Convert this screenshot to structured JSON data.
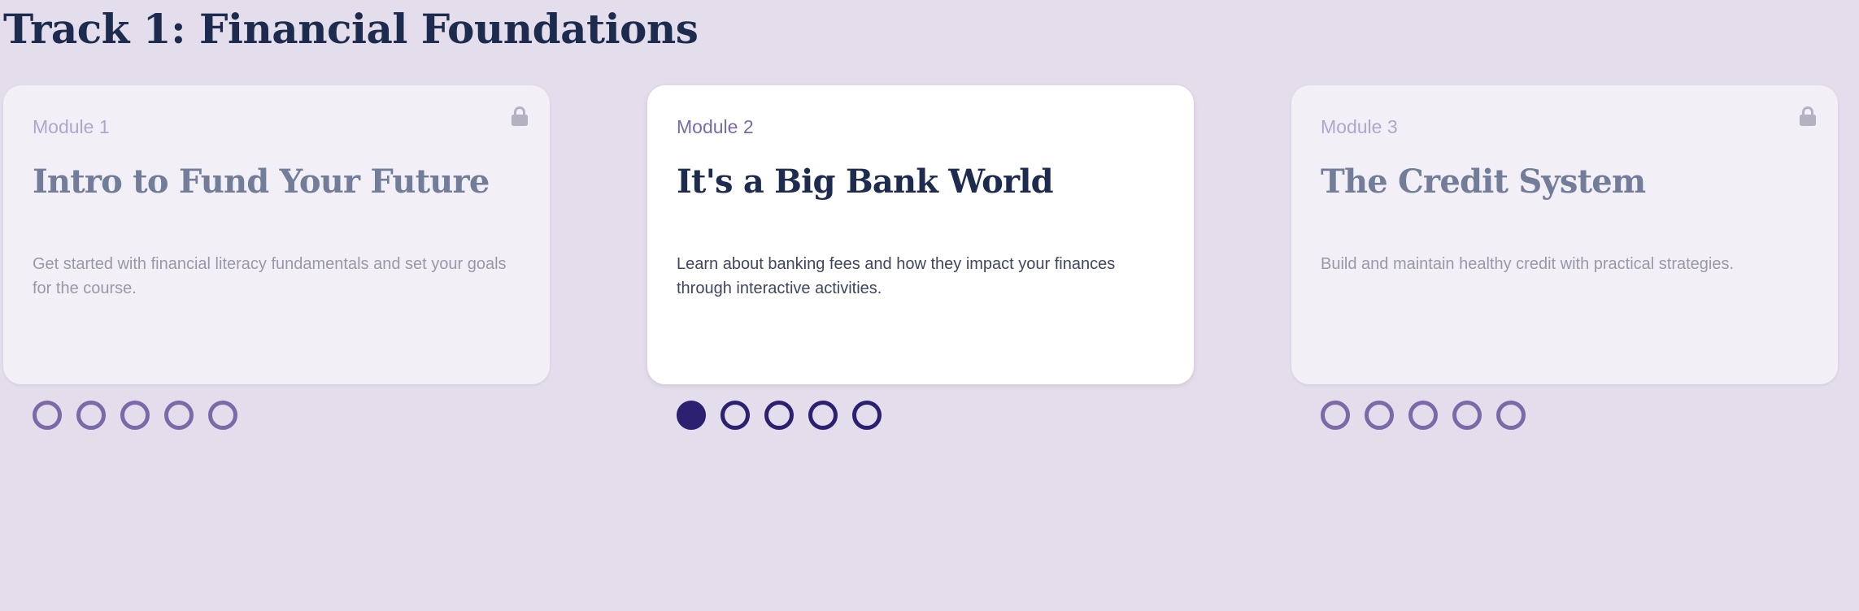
{
  "track": {
    "title": "Track 1: Financial Foundations"
  },
  "modules": [
    {
      "label": "Module 1",
      "title": "Intro to Fund Your Future",
      "description": "Get started with financial literacy fundamentals and set your goals for the course.",
      "locked": true,
      "icon": "lock-icon",
      "progress": {
        "completed": 0,
        "total": 5
      }
    },
    {
      "label": "Module 2",
      "title": "It's a Big Bank World",
      "description": "Learn about banking fees and how they impact your finances through interactive activities.",
      "locked": false,
      "progress": {
        "completed": 1,
        "total": 5
      }
    },
    {
      "label": "Module 3",
      "title": "The Credit System",
      "description": "Build and maintain healthy credit with practical strategies.",
      "locked": true,
      "icon": "lock-icon",
      "progress": {
        "completed": 0,
        "total": 5
      }
    }
  ],
  "colors": {
    "background": "#e4ddec",
    "title": "#1c2b4e",
    "active_dot": "#2c2170",
    "inactive_dot": "#7c6aa8",
    "lock": "#b4b1c0"
  }
}
